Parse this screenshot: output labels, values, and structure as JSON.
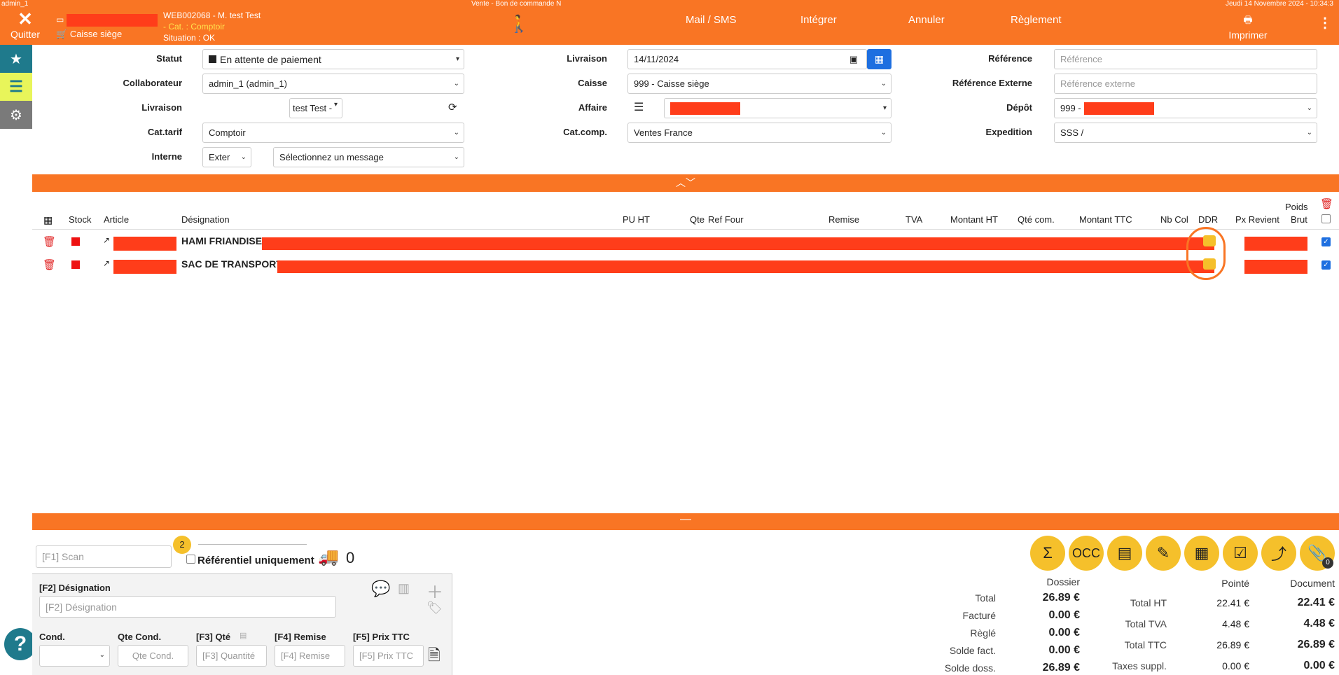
{
  "topbar": {
    "user": "admin_1",
    "window_title": "Vente - Bon de commande N",
    "datetime": "Jeudi 14 Novembre 2024 - 10:34:3",
    "quit_label": "Quitter",
    "caisse_label": "Caisse siège",
    "doc_ref": "WEB002068 - M. test Test",
    "cat": "- Cat. : Comptoir",
    "situation": "Situation : OK",
    "mail_sms": "Mail / SMS",
    "integrer": "Intégrer",
    "annuler": "Annuler",
    "reglement": "Règlement",
    "imprimer": "Imprimer"
  },
  "form": {
    "statut_label": "Statut",
    "statut_value": "En attente de paiement",
    "collaborateur_label": "Collaborateur",
    "collaborateur_value": "admin_1 (admin_1)",
    "livraison_label": "Livraison",
    "livraison_value": "test Test -",
    "cattarif_label": "Cat.tarif",
    "cattarif_value": "Comptoir",
    "interne_label": "Interne",
    "interne_value": "Exter",
    "message_value": "Sélectionnez un message",
    "livraison_date_label": "Livraison",
    "livraison_date_value": "14/11/2024",
    "caisse_label": "Caisse",
    "caisse_value": "999 - Caisse siège",
    "affaire_label": "Affaire",
    "catcomp_label": "Cat.comp.",
    "catcomp_value": "Ventes France",
    "reference_label": "Référence",
    "reference_placeholder": "Référence",
    "refext_label": "Référence Externe",
    "refext_placeholder": "Référence externe",
    "depot_label": "Dépôt",
    "depot_value": "999 -",
    "expedition_label": "Expedition",
    "expedition_value": "SSS /"
  },
  "table": {
    "headers": {
      "stock": "Stock",
      "article": "Article",
      "designation": "Désignation",
      "puht": "PU HT",
      "qte": "Qte",
      "reffour": "Ref Four",
      "remise": "Remise",
      "tva": "TVA",
      "montantht": "Montant HT",
      "qtecom": "Qté com.",
      "montantttc": "Montant TTC",
      "nbcol": "Nb Col",
      "ddr": "DDR",
      "pxrevient": "Px Revient",
      "poids": "Poids",
      "brut": "Brut"
    },
    "rows": [
      {
        "designation": "HAMI FRIANDISE"
      },
      {
        "designation": "SAC DE TRANSPORT"
      }
    ]
  },
  "bottom": {
    "scan_placeholder": "[F1] Scan",
    "badge_count": "2",
    "referentiel_label": "Référentiel uniquement",
    "truck_count": "0",
    "occ_label": "OCC",
    "attach_count": "0",
    "designation_label": "[F2] Désignation",
    "designation_placeholder": "[F2] Désignation",
    "cond_label": "Cond.",
    "qtecond_label": "Qte Cond.",
    "qtecond_placeholder": "Qte Cond.",
    "qte_label": "[F3] Qté",
    "qte_placeholder": "[F3] Quantité",
    "remise_label": "[F4] Remise",
    "remise_placeholder": "[F4] Remise",
    "prix_label": "[F5] Prix TTC",
    "prix_placeholder": "[F5] Prix TTC"
  },
  "totals": {
    "dossier_header": "Dossier",
    "pointe_header": "Pointé",
    "document_header": "Document",
    "total_label": "Total",
    "total_value": "26.89 €",
    "facture_label": "Facturé",
    "facture_value": "0.00 €",
    "regle_label": "Règlé",
    "regle_value": "0.00 €",
    "soldefact_label": "Solde fact.",
    "soldefact_value": "0.00 €",
    "soldedoss_label": "Solde doss.",
    "soldedoss_value": "26.89 €",
    "totalht_label": "Total HT",
    "totalht_pointe": "22.41 €",
    "totalht_doc": "22.41 €",
    "totaltva_label": "Total TVA",
    "totaltva_pointe": "4.48 €",
    "totaltva_doc": "4.48 €",
    "totalttc_label": "Total TTC",
    "totalttc_pointe": "26.89 €",
    "totalttc_doc": "26.89 €",
    "taxes_label": "Taxes suppl.",
    "taxes_pointe": "0.00 €",
    "taxes_doc": "0.00 €"
  },
  "colors": {
    "accent": "#f97524",
    "redact": "#ff3d1a",
    "yellow": "#f5c02b",
    "teal": "#1f7a8c"
  }
}
